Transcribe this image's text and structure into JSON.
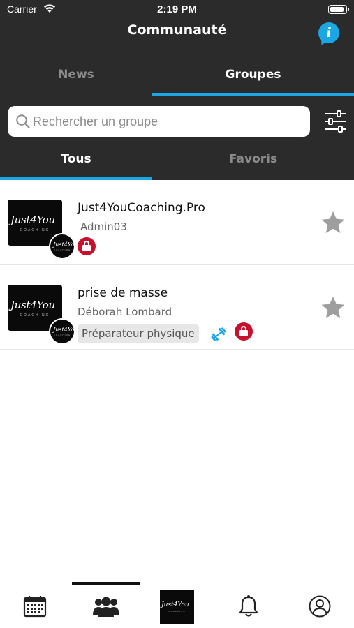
{
  "status_bar": {
    "carrier": "Carrier",
    "time": "2:19 PM"
  },
  "header": {
    "title": "Communauté",
    "info_icon": "info-icon"
  },
  "top_tabs": [
    {
      "label": "News",
      "active": false
    },
    {
      "label": "Groupes",
      "active": true
    }
  ],
  "search": {
    "placeholder": "Rechercher un groupe",
    "value": ""
  },
  "sub_tabs": [
    {
      "label": "Tous",
      "active": true
    },
    {
      "label": "Favoris",
      "active": false
    }
  ],
  "groups": [
    {
      "name": "Just4YouCoaching.Pro",
      "admin": "Admin03",
      "tag": "",
      "private": true,
      "favorite": false
    },
    {
      "name": "prise de masse",
      "admin": "Déborah Lombard",
      "tag": "Préparateur physique",
      "private": true,
      "favorite": false
    }
  ],
  "logo": {
    "text": "Just4You",
    "subtext": "COACHING"
  },
  "colors": {
    "accent": "#1ba7e3",
    "header_bg": "#2b2b2b",
    "lock": "#c8102e",
    "star": "#9e9e9e"
  },
  "tab_bar": [
    "calendar-icon",
    "community-icon",
    "logo",
    "bell-icon",
    "profile-icon"
  ]
}
